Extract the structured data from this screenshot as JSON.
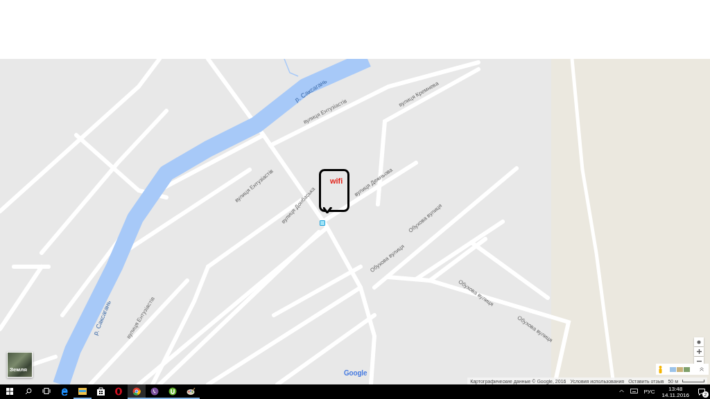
{
  "map": {
    "labels": [
      {
        "kind": "river",
        "text": "р. Саксагань"
      },
      {
        "kind": "river",
        "text": "р. Саксагань"
      },
      {
        "kind": "street",
        "text": "вулиця Ентузіастів"
      },
      {
        "kind": "street",
        "text": "вулиця Ентузіастів"
      },
      {
        "kind": "street",
        "text": "вулиця Ентузіастів"
      },
      {
        "kind": "street",
        "text": "вулиця Кремнева"
      },
      {
        "kind": "street",
        "text": "вулиця Дежньова"
      },
      {
        "kind": "street",
        "text": "вулиця Донбаська"
      },
      {
        "kind": "street",
        "text": "Обухова вулиця"
      },
      {
        "kind": "street",
        "text": "Обухова вулиця"
      },
      {
        "kind": "street",
        "text": "Обухова вулиця"
      },
      {
        "kind": "street",
        "text": "Обухова вулиця"
      }
    ],
    "callout": {
      "text": "wifi"
    },
    "layer_thumbnail": {
      "label": "Земля"
    },
    "logo": "Google",
    "attribution": [
      "Картографические данные © Google, 2016",
      "Условия использования",
      "Оставить отзыв"
    ],
    "scale": "50 м"
  },
  "taskbar": {
    "apps": [
      {
        "kind": "edge",
        "running": false,
        "selected": false
      },
      {
        "kind": "explorer",
        "running": true,
        "selected": false
      },
      {
        "kind": "store",
        "running": false,
        "selected": false
      },
      {
        "kind": "opera",
        "running": false,
        "selected": false
      },
      {
        "kind": "chrome",
        "running": true,
        "selected": true
      },
      {
        "kind": "viber",
        "running": true,
        "selected": false
      },
      {
        "kind": "utorrent",
        "running": true,
        "selected": false
      },
      {
        "kind": "paint",
        "running": true,
        "selected": false
      }
    ],
    "tray": {
      "language": "РУС",
      "time": "13:48",
      "date": "14.11.2016",
      "notifications": "2"
    }
  }
}
